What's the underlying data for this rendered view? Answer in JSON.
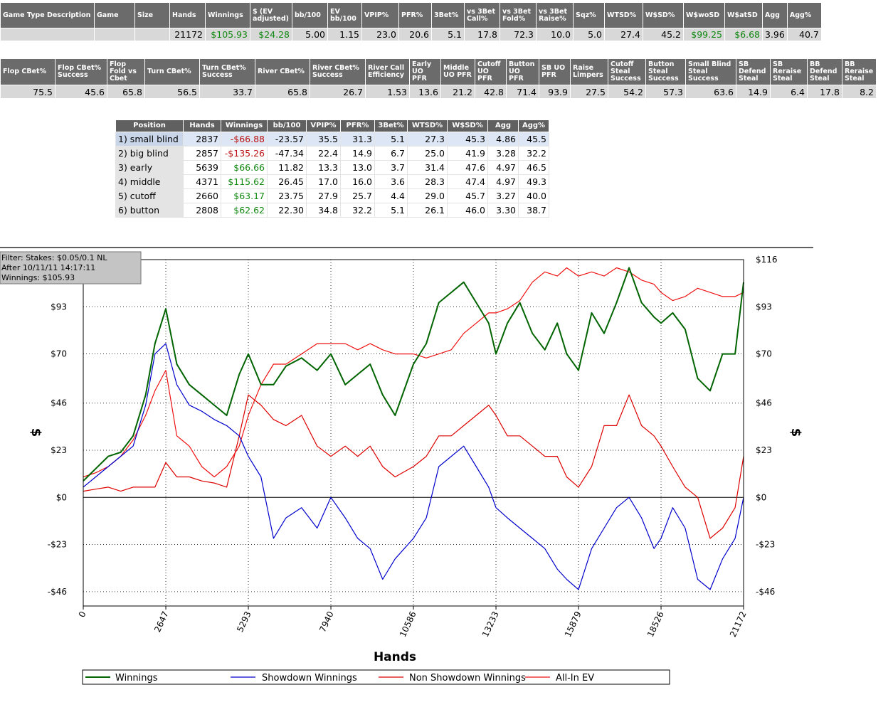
{
  "summary_table": {
    "headers": [
      "Game Type Description",
      "Game",
      "Size",
      "Hands",
      "Winnings",
      "$ (EV adjusted)",
      "bb/100",
      "EV bb/100",
      "VPIP%",
      "PFR%",
      "3Bet%",
      "vs 3Bet Call%",
      "vs 3Bet Fold%",
      "vs 3Bet Raise%",
      "Sqz%",
      "WTSD%",
      "W$SD%",
      "W$woSD",
      "W$atSD",
      "Agg",
      "Agg%"
    ],
    "values": [
      "",
      "",
      "",
      "21172",
      "$105.93",
      "$24.28",
      "5.00",
      "1.15",
      "23.0",
      "20.6",
      "5.1",
      "17.8",
      "72.3",
      "10.0",
      "5.0",
      "27.4",
      "45.2",
      "$99.25",
      "$6.68",
      "3.96",
      "40.7"
    ]
  },
  "cbet_table": {
    "headers": [
      "Flop CBet%",
      "Flop CBet% Success",
      "Flop Fold vs Cbet",
      "Turn CBet%",
      "Turn CBet% Success",
      "River CBet%",
      "River CBet% Success",
      "River Call Efficiency",
      "Early UO PFR",
      "Middle UO PFR",
      "Cutoff UO PFR",
      "Button UO PFR",
      "SB UO PFR",
      "Raise Limpers",
      "Cutoff Steal Success",
      "Button Steal Success",
      "Small Blind Steal Success",
      "SB Defend Steal",
      "SB Reraise Steal",
      "BB Defend Steal",
      "BB Reraise Steal"
    ],
    "values": [
      "75.5",
      "45.6",
      "65.8",
      "56.5",
      "33.7",
      "65.8",
      "26.7",
      "1.53",
      "13.6",
      "21.2",
      "42.8",
      "71.4",
      "93.9",
      "27.5",
      "54.2",
      "57.3",
      "63.6",
      "14.9",
      "6.4",
      "17.8",
      "8.2"
    ]
  },
  "position_table": {
    "headers": [
      "Position",
      "Hands",
      "Winnings",
      "bb/100",
      "VPIP%",
      "PFR%",
      "3Bet%",
      "WTSD%",
      "W$SD%",
      "Agg",
      "Agg%"
    ],
    "rows": [
      [
        "1) small blind",
        "2837",
        "-$66.88",
        "-23.57",
        "35.5",
        "31.3",
        "5.1",
        "27.3",
        "45.3",
        "4.86",
        "45.5"
      ],
      [
        "2) big blind",
        "2857",
        "-$135.26",
        "-47.34",
        "22.4",
        "14.9",
        "6.7",
        "25.0",
        "41.9",
        "3.28",
        "32.2"
      ],
      [
        "3) early",
        "5639",
        "$66.66",
        "11.82",
        "13.3",
        "13.0",
        "3.7",
        "31.4",
        "47.6",
        "4.97",
        "46.5"
      ],
      [
        "4) middle",
        "4371",
        "$115.62",
        "26.45",
        "17.0",
        "16.0",
        "3.6",
        "28.3",
        "47.4",
        "4.97",
        "49.3"
      ],
      [
        "5) cutoff",
        "2660",
        "$63.17",
        "23.75",
        "27.9",
        "25.7",
        "4.4",
        "29.0",
        "45.7",
        "3.27",
        "40.0"
      ],
      [
        "6) button",
        "2808",
        "$62.62",
        "22.30",
        "34.8",
        "32.2",
        "5.1",
        "26.1",
        "46.0",
        "3.30",
        "38.7"
      ]
    ]
  },
  "chart_data": {
    "type": "line",
    "xlabel": "Hands",
    "ylabel": "$",
    "xlim": [
      0,
      21172
    ],
    "ylim": [
      -53,
      116
    ],
    "x_ticks": [
      "0",
      "2647",
      "5293",
      "7940",
      "10586",
      "13233",
      "15879",
      "18526",
      "21172"
    ],
    "y_ticks": [
      "$116",
      "$93",
      "$70",
      "$46",
      "$23",
      "$0",
      "-$23",
      "-$46"
    ],
    "info_box": [
      "Filter: Stakes: $0.05/0.1 NL",
      "After 10/11/11 14:17:11",
      "Winnings: $105.93"
    ],
    "legend_position": "bottom",
    "grid": true,
    "series": [
      {
        "name": "Winnings",
        "color": "#006400",
        "x": [
          0,
          400,
          800,
          1200,
          1600,
          2000,
          2300,
          2647,
          3000,
          3400,
          3800,
          4200,
          4600,
          5000,
          5293,
          5700,
          6100,
          6500,
          7000,
          7500,
          7940,
          8400,
          8800,
          9200,
          9600,
          10000,
          10586,
          11000,
          11400,
          11800,
          12200,
          12600,
          13000,
          13233,
          13600,
          14000,
          14400,
          14800,
          15200,
          15500,
          15879,
          16300,
          16700,
          17100,
          17500,
          17900,
          18300,
          18526,
          18900,
          19300,
          19700,
          20100,
          20500,
          20900,
          21172
        ],
        "y": [
          8,
          14,
          20,
          22,
          30,
          50,
          75,
          92,
          65,
          55,
          50,
          45,
          40,
          60,
          70,
          55,
          55,
          64,
          68,
          62,
          70,
          55,
          60,
          65,
          50,
          40,
          65,
          75,
          95,
          100,
          105,
          95,
          85,
          70,
          85,
          95,
          80,
          72,
          85,
          70,
          62,
          90,
          80,
          95,
          112,
          95,
          88,
          85,
          90,
          82,
          58,
          52,
          70,
          70,
          105
        ]
      },
      {
        "name": "Showdown Winnings",
        "color": "#0000cc",
        "x": [
          0,
          400,
          800,
          1200,
          1600,
          2000,
          2300,
          2647,
          3000,
          3400,
          3800,
          4200,
          4600,
          5000,
          5293,
          5700,
          6100,
          6500,
          7000,
          7500,
          7940,
          8400,
          8800,
          9200,
          9600,
          10000,
          10586,
          11000,
          11400,
          11800,
          12200,
          12600,
          13000,
          13233,
          13600,
          14000,
          14400,
          14800,
          15200,
          15500,
          15879,
          16300,
          16700,
          17100,
          17500,
          17900,
          18300,
          18526,
          18900,
          19300,
          19700,
          20100,
          20500,
          20900,
          21172
        ],
        "y": [
          5,
          10,
          15,
          20,
          25,
          45,
          70,
          75,
          55,
          45,
          42,
          38,
          35,
          30,
          20,
          10,
          -20,
          -10,
          -5,
          -15,
          0,
          -10,
          -20,
          -25,
          -40,
          -30,
          -20,
          -10,
          15,
          20,
          25,
          15,
          5,
          -5,
          -10,
          -15,
          -20,
          -25,
          -35,
          -40,
          -45,
          -25,
          -15,
          -5,
          0,
          -10,
          -25,
          -20,
          -5,
          -15,
          -40,
          -45,
          -30,
          -20,
          0
        ]
      },
      {
        "name": "Non Showdown Winnings",
        "color": "#dd0000",
        "x": [
          0,
          400,
          800,
          1200,
          1600,
          2000,
          2300,
          2647,
          3000,
          3400,
          3800,
          4200,
          4600,
          5000,
          5293,
          5700,
          6100,
          6500,
          7000,
          7500,
          7940,
          8400,
          8800,
          9200,
          9600,
          10000,
          10586,
          11000,
          11400,
          11800,
          12200,
          12600,
          13000,
          13233,
          13600,
          14000,
          14400,
          14800,
          15200,
          15500,
          15879,
          16300,
          16700,
          17100,
          17500,
          17900,
          18300,
          18526,
          18900,
          19300,
          19700,
          20100,
          20500,
          20900,
          21172
        ],
        "y": [
          3,
          4,
          5,
          3,
          5,
          5,
          5,
          17,
          10,
          10,
          8,
          7,
          5,
          30,
          50,
          45,
          38,
          35,
          40,
          25,
          20,
          25,
          20,
          25,
          15,
          10,
          15,
          20,
          30,
          30,
          35,
          40,
          45,
          40,
          30,
          30,
          25,
          20,
          20,
          10,
          5,
          15,
          35,
          35,
          50,
          35,
          30,
          25,
          15,
          5,
          0,
          -20,
          -15,
          -5,
          20
        ]
      },
      {
        "name": "All-In EV",
        "color": "#ee1111",
        "x": [
          0,
          400,
          800,
          1200,
          1600,
          2000,
          2300,
          2647,
          3000,
          3400,
          3800,
          4200,
          4600,
          5000,
          5293,
          5700,
          6100,
          6500,
          7000,
          7500,
          7940,
          8400,
          8800,
          9200,
          9600,
          10000,
          10586,
          11000,
          11400,
          11800,
          12200,
          12600,
          13000,
          13233,
          13600,
          14000,
          14400,
          14800,
          15200,
          15500,
          15879,
          16300,
          16700,
          17100,
          17500,
          17900,
          18300,
          18526,
          18900,
          19300,
          19700,
          20100,
          20500,
          20900,
          21172
        ],
        "y": [
          10,
          12,
          15,
          20,
          28,
          40,
          52,
          62,
          30,
          25,
          15,
          10,
          15,
          25,
          40,
          55,
          65,
          65,
          70,
          75,
          75,
          75,
          72,
          75,
          72,
          70,
          70,
          68,
          70,
          72,
          80,
          85,
          90,
          90,
          92,
          96,
          105,
          110,
          108,
          112,
          108,
          110,
          108,
          112,
          110,
          106,
          104,
          100,
          96,
          98,
          102,
          100,
          98,
          98,
          100
        ]
      }
    ]
  }
}
